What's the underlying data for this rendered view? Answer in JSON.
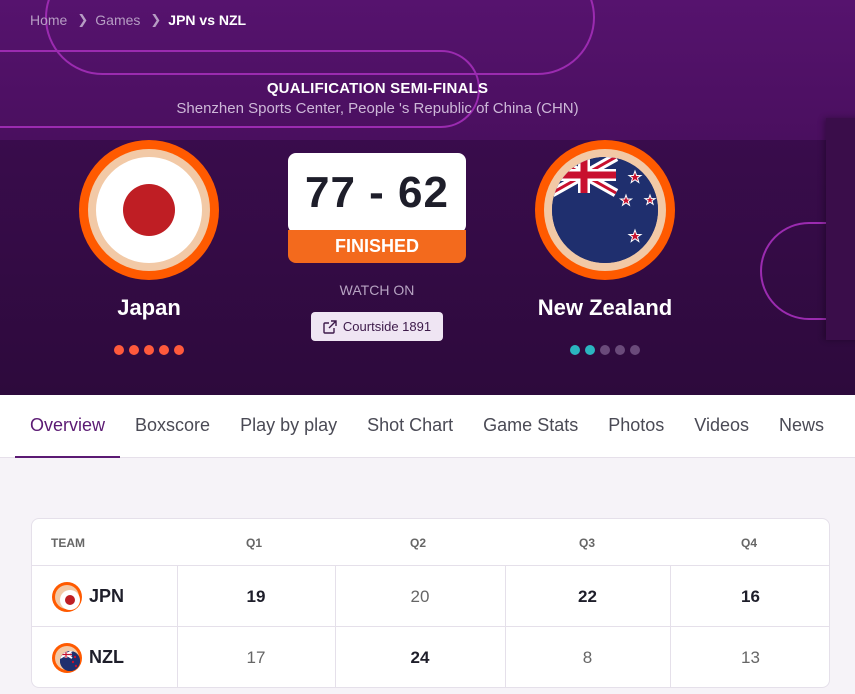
{
  "breadcrumb": {
    "home": "Home",
    "games": "Games",
    "current": "JPN vs NZL"
  },
  "game": {
    "stage": "QUALIFICATION SEMI-FINALS",
    "venue": "Shenzhen Sports Center, People 's Republic of China (CHN)",
    "score": "77 - 62",
    "status": "FINISHED",
    "watch_on": "WATCH ON",
    "broadcaster": "Courtside 1891"
  },
  "home_team": {
    "name": "Japan",
    "flag_icon": "japan-flag-icon",
    "form_colors": [
      "#ff5a3c",
      "#ff5a3c",
      "#ff5a3c",
      "#ff5a3c",
      "#ff5a3c"
    ]
  },
  "away_team": {
    "name": "New Zealand",
    "flag_icon": "new-zealand-flag-icon",
    "form_colors": [
      "#2bb5c0",
      "#2bb5c0",
      "#6a4a7a",
      "#6a4a7a",
      "#6a4a7a"
    ]
  },
  "tabs": [
    "Overview",
    "Boxscore",
    "Play by play",
    "Shot Chart",
    "Game Stats",
    "Photos",
    "Videos",
    "News"
  ],
  "active_tab": "Overview",
  "scores_table": {
    "headers": [
      "TEAM",
      "Q1",
      "Q2",
      "Q3",
      "Q4"
    ],
    "rows": [
      {
        "team": "JPN",
        "q": [
          "19",
          "20",
          "22",
          "16"
        ]
      },
      {
        "team": "NZL",
        "q": [
          "17",
          "24",
          "8",
          "13"
        ]
      }
    ]
  },
  "colors": {
    "accent": "#5b1a73",
    "hero": "#3a0c4d",
    "finished": "#f36a1d",
    "ring": "#ff5a00"
  }
}
